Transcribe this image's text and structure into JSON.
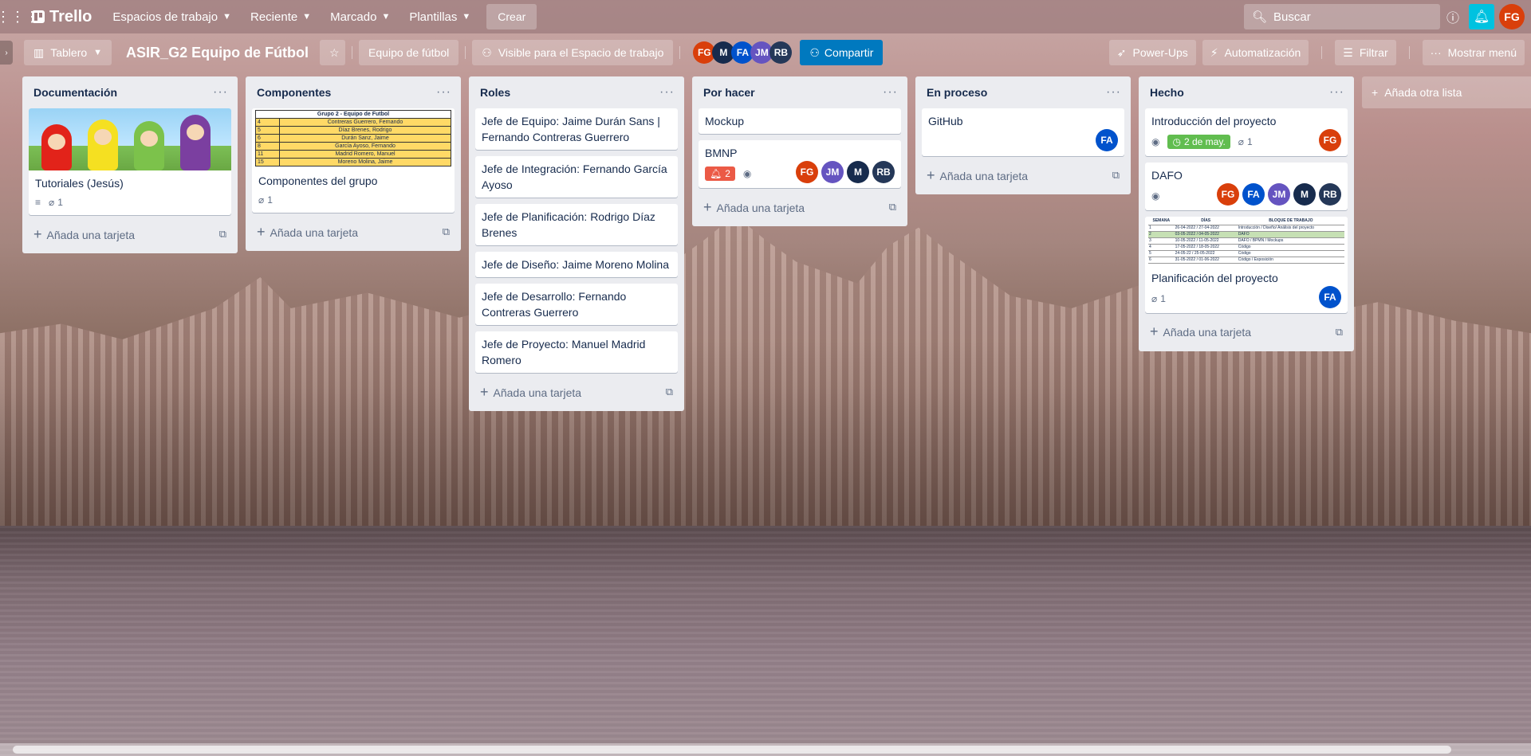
{
  "header": {
    "brand": "Trello",
    "nav": [
      {
        "label": "Espacios de trabajo"
      },
      {
        "label": "Reciente"
      },
      {
        "label": "Marcado"
      },
      {
        "label": "Plantillas"
      }
    ],
    "create_label": "Crear",
    "search_placeholder": "Buscar",
    "user_initials": "FG",
    "user_color": "#d93f0b"
  },
  "board": {
    "view_label": "Tablero",
    "title": "ASIR_G2 Equipo de Fútbol",
    "workspace_label": "Equipo de fútbol",
    "visibility_label": "Visible para el Espacio de trabajo",
    "members": [
      {
        "initials": "FG",
        "color": "#d93f0b"
      },
      {
        "initials": "M",
        "color": "#172b4d"
      },
      {
        "initials": "FA",
        "color": "#0052cc"
      },
      {
        "initials": "JM",
        "color": "#6554c0"
      },
      {
        "initials": "RB",
        "color": "#253858"
      }
    ],
    "share_label": "Compartir",
    "powerups_label": "Power-Ups",
    "automation_label": "Automatización",
    "filter_label": "Filtrar",
    "menu_label": "Mostrar menú"
  },
  "labels": {
    "add_card": "Añada una tarjeta",
    "add_list": "Añada otra lista"
  },
  "lists": [
    {
      "title": "Documentación",
      "cards": [
        {
          "title": "Tutoriales (Jesús)",
          "attachments": "1"
        }
      ]
    },
    {
      "title": "Componentes",
      "sheet": {
        "header": "Grupo 2 - Equipo de Futbol",
        "rows": [
          {
            "num": "4",
            "name": "Contreras Guerrero, Fernando"
          },
          {
            "num": "5",
            "name": "Díaz Brenes, Rodrigo"
          },
          {
            "num": "6",
            "name": "Durán Sanz, Jaime"
          },
          {
            "num": "8",
            "name": "García Ayoso, Fernando"
          },
          {
            "num": "11",
            "name": "Madrid Romero, Manuel"
          },
          {
            "num": "15",
            "name": "Moreno Molina, Jaime"
          }
        ]
      },
      "cards": [
        {
          "title": "Componentes del grupo",
          "attachments": "1"
        }
      ]
    },
    {
      "title": "Roles",
      "cards": [
        {
          "title": "Jefe de Equipo: Jaime Durán Sans | Fernando Contreras Guerrero"
        },
        {
          "title": "Jefe de Integración: Fernando García Ayoso"
        },
        {
          "title": "Jefe de Planificación: Rodrigo Díaz Brenes"
        },
        {
          "title": "Jefe de Diseño: Jaime Moreno Molina"
        },
        {
          "title": "Jefe de Desarrollo: Fernando Contreras Guerrero"
        },
        {
          "title": "Jefe de Proyecto: Manuel Madrid Romero"
        }
      ]
    },
    {
      "title": "Por hacer",
      "cards": [
        {
          "title": "Mockup"
        },
        {
          "title": "BMNP",
          "notifications": "2"
        }
      ]
    },
    {
      "title": "En proceso",
      "cards": [
        {
          "title": "GitHub"
        }
      ]
    },
    {
      "title": "Hecho",
      "cards": [
        {
          "title": "Introducción del proyecto",
          "due": "2 de may.",
          "attachments": "1"
        },
        {
          "title": "DAFO"
        },
        {
          "title": "Planificación del proyecto",
          "attachments": "1"
        }
      ],
      "plan_sheet": {
        "headers": [
          "SEMANA",
          "DÍAS",
          "BLOQUE DE TRABAJO"
        ],
        "rows": [
          [
            "1",
            "26-04-2022 / 27-04-2022",
            "Introducción / Diseño/ Análisis del proyecto"
          ],
          [
            "2",
            "03-05-2022 / 04-05-2022",
            "DAFO"
          ],
          [
            "3",
            "10-05-2022 / 11-05-2022",
            "DAFO / BPMN / Mockups"
          ],
          [
            "4",
            "17-05-2022 / 18-05-2022",
            "Código"
          ],
          [
            "5",
            "24-05-22 / 25-05-2022",
            "Código"
          ],
          [
            "6",
            "31-05-2022 / 01-06-2022",
            "Código / Exposición"
          ]
        ]
      }
    }
  ],
  "card_members": {
    "bmnp": [
      {
        "initials": "FG",
        "color": "#d93f0b"
      },
      {
        "initials": "JM",
        "color": "#6554c0"
      },
      {
        "initials": "M",
        "color": "#172b4d"
      },
      {
        "initials": "RB",
        "color": "#253858"
      }
    ],
    "github": [
      {
        "initials": "FA",
        "color": "#0052cc"
      }
    ],
    "intro": [
      {
        "initials": "FG",
        "color": "#d93f0b"
      }
    ],
    "dafo": [
      {
        "initials": "FG",
        "color": "#d93f0b"
      },
      {
        "initials": "FA",
        "color": "#0052cc"
      },
      {
        "initials": "JM",
        "color": "#6554c0"
      },
      {
        "initials": "M",
        "color": "#172b4d"
      },
      {
        "initials": "RB",
        "color": "#253858"
      }
    ],
    "plan": [
      {
        "initials": "FA",
        "color": "#0052cc"
      }
    ]
  }
}
